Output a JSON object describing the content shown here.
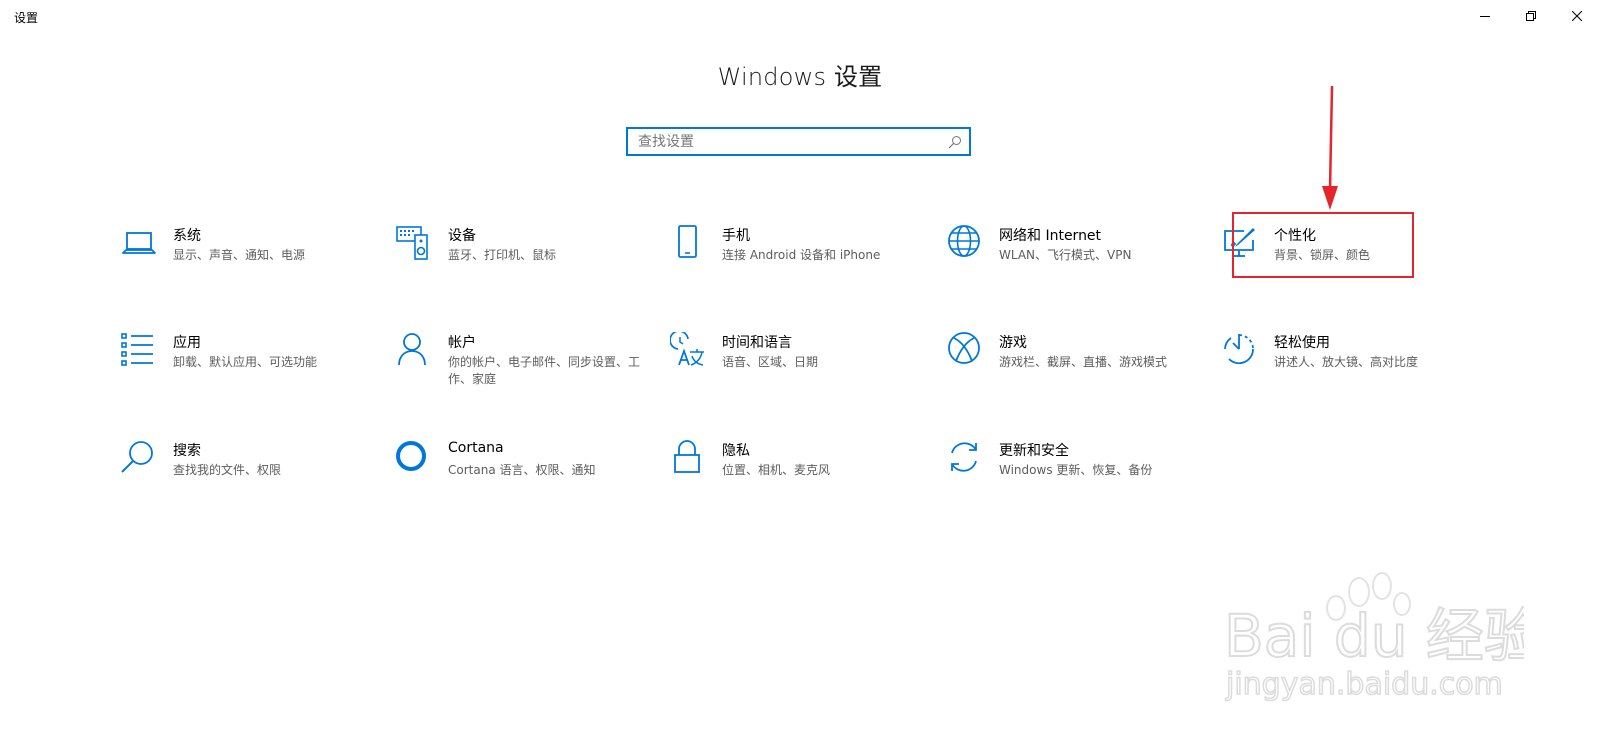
{
  "window": {
    "title": "设置"
  },
  "page": {
    "title": "Windows 设置"
  },
  "search": {
    "placeholder": "查找设置",
    "value": ""
  },
  "tiles": [
    {
      "label": "系统",
      "desc": "显示、声音、通知、电源",
      "icon": "laptop-icon"
    },
    {
      "label": "设备",
      "desc": "蓝牙、打印机、鼠标",
      "icon": "devices-icon"
    },
    {
      "label": "手机",
      "desc": "连接 Android 设备和 iPhone",
      "icon": "phone-icon"
    },
    {
      "label": "网络和 Internet",
      "desc": "WLAN、飞行模式、VPN",
      "icon": "globe-icon"
    },
    {
      "label": "个性化",
      "desc": "背景、锁屏、颜色",
      "icon": "personalization-icon"
    },
    {
      "label": "应用",
      "desc": "卸载、默认应用、可选功能",
      "icon": "apps-list-icon"
    },
    {
      "label": "帐户",
      "desc": "你的帐户、电子邮件、同步设置、工作、家庭",
      "icon": "person-icon"
    },
    {
      "label": "时间和语言",
      "desc": "语音、区域、日期",
      "icon": "time-language-icon"
    },
    {
      "label": "游戏",
      "desc": "游戏栏、截屏、直播、游戏模式",
      "icon": "xbox-icon"
    },
    {
      "label": "轻松使用",
      "desc": "讲述人、放大镜、高对比度",
      "icon": "ease-of-access-icon"
    },
    {
      "label": "搜索",
      "desc": "查找我的文件、权限",
      "icon": "search-icon"
    },
    {
      "label": "Cortana",
      "desc": "Cortana 语言、权限、通知",
      "icon": "cortana-icon"
    },
    {
      "label": "隐私",
      "desc": "位置、相机、麦克风",
      "icon": "lock-icon"
    },
    {
      "label": "更新和安全",
      "desc": "Windows 更新、恢复、备份",
      "icon": "update-icon"
    }
  ],
  "colors": {
    "accent": "#0078d7",
    "highlight": "#e5242b"
  },
  "watermark": {
    "brand": "Bai du 经验",
    "url": "jingyan.baidu.com"
  }
}
